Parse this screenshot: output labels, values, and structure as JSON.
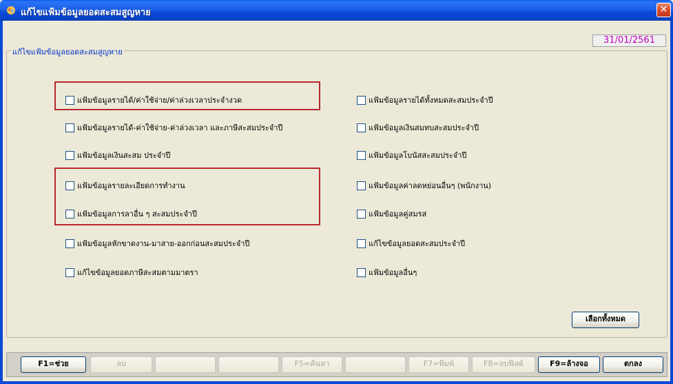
{
  "window": {
    "title": "แก้ไขแฟ้มข้อมูลยอดสะสมสูญหาย",
    "close_label": "✕",
    "date": "31/01/2561"
  },
  "group": {
    "legend": "แก้ไขแฟ้มข้อมูลยอดสะสมสูญหาย"
  },
  "left_items": [
    "แฟ้มข้อมูลรายได้/ค่าใช้จ่าย/ค่าล่วงเวลาประจำงวด",
    "แฟ้มข้อมูลรายได้-ค่าใช้จ่าย-ค่าล่วงเวลา และภาษีสะสมประจำปี",
    "แฟ้มข้อมูลเงินสะสม ประจำปี",
    "แฟ้มข้อมูลรายละเอียดการทำงาน",
    "แฟ้มข้อมูลการลาอื่น ๆ สะสมประจำปี",
    "แฟ้มข้อมูลหักขาดงาน-มาสาย-ออกก่อนสะสมประจำปี",
    "แก้ไขข้อมูลยอดภาษีสะสมตามมาตรา"
  ],
  "right_items": [
    "แฟ้มข้อมูลรายได้ทั้งหมดสะสมประจำปี",
    "แฟ้มข้อมูลเงินสมทบสะสมประจำปี",
    "แฟ้มข้อมูลโบนัสสะสมประจำปี",
    "แฟ้มข้อมูลค่าลดหย่อนอื่นๆ (พนักงาน)",
    "แฟ้มข้อมูลคู่สมรส",
    "แก้ไขข้อมูลยอดสะสมประจำปี",
    "แฟ้มข้อมูลอื่นๆ"
  ],
  "select_all_label": "เลือกทั้งหมด",
  "toolbar": {
    "f1": "F1=ช่วย",
    "delete": "ลบ",
    "blank1": "",
    "blank2": "",
    "f5": "F5=ค้นหา",
    "blank3": "",
    "f7": "F7=พิมพ์",
    "f8": "F8=ลบฟิลด์",
    "f9": "F9=ล้างจอ",
    "ok": "ตกลง"
  }
}
